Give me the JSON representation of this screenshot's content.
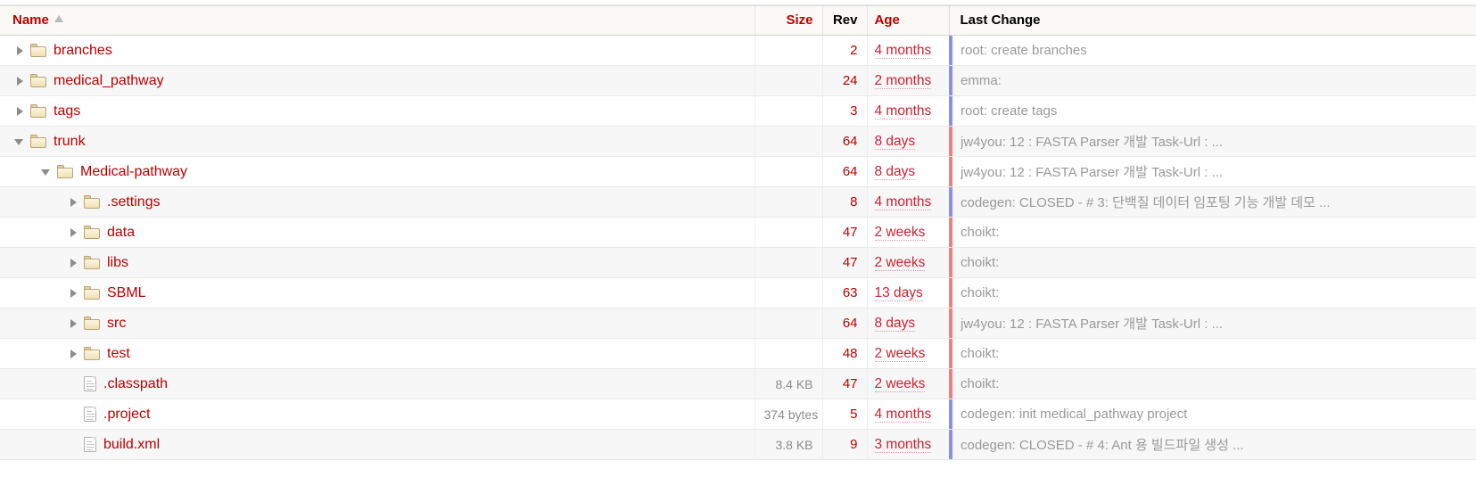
{
  "columns": {
    "name": {
      "label": "Name",
      "link": true,
      "sorted": true,
      "sort_dir": "asc"
    },
    "size": {
      "label": "Size",
      "link": true
    },
    "rev": {
      "label": "Rev",
      "link": false
    },
    "age": {
      "label": "Age",
      "link": true
    },
    "last_change": {
      "label": "Last Change",
      "link": false
    }
  },
  "colors": {
    "link_red": "#bb0000",
    "age_red": "#cc2233",
    "message_gray": "#999999",
    "header_bg": "#faf9f5",
    "row_alt_bg": "#f7f7f7",
    "age_bar_old": "#8e8ee8",
    "age_bar_recent": "#f08080"
  },
  "rows": [
    {
      "name": "branches",
      "kind": "dir",
      "depth": 0,
      "twisty": "collapsed",
      "size": "",
      "rev": "2",
      "age": "4 months",
      "change": "root: create branches",
      "bar": "old"
    },
    {
      "name": "medical_pathway",
      "kind": "dir",
      "depth": 0,
      "twisty": "collapsed",
      "size": "",
      "rev": "24",
      "age": "2 months",
      "change": "emma:",
      "bar": "old"
    },
    {
      "name": "tags",
      "kind": "dir",
      "depth": 0,
      "twisty": "collapsed",
      "size": "",
      "rev": "3",
      "age": "4 months",
      "change": "root: create tags",
      "bar": "old"
    },
    {
      "name": "trunk",
      "kind": "dir",
      "depth": 0,
      "twisty": "expanded",
      "size": "",
      "rev": "64",
      "age": "8 days",
      "change": "jw4you: 12 : FASTA Parser 개발 Task-Url : ...",
      "bar": "recent"
    },
    {
      "name": "Medical-pathway",
      "kind": "dir",
      "depth": 1,
      "twisty": "expanded",
      "size": "",
      "rev": "64",
      "age": "8 days",
      "change": "jw4you: 12 : FASTA Parser 개발 Task-Url : ...",
      "bar": "recent"
    },
    {
      "name": ".settings",
      "kind": "dir",
      "depth": 2,
      "twisty": "collapsed",
      "size": "",
      "rev": "8",
      "age": "4 months",
      "change": "codegen: CLOSED - # 3: 단백질 데이터 임포팅 기능 개발 데모 ...",
      "bar": "old"
    },
    {
      "name": "data",
      "kind": "dir",
      "depth": 2,
      "twisty": "collapsed",
      "size": "",
      "rev": "47",
      "age": "2 weeks",
      "change": "choikt:",
      "bar": "recent"
    },
    {
      "name": "libs",
      "kind": "dir",
      "depth": 2,
      "twisty": "collapsed",
      "size": "",
      "rev": "47",
      "age": "2 weeks",
      "change": "choikt:",
      "bar": "recent"
    },
    {
      "name": "SBML",
      "kind": "dir",
      "depth": 2,
      "twisty": "collapsed",
      "size": "",
      "rev": "63",
      "age": "13 days",
      "change": "choikt:",
      "bar": "recent"
    },
    {
      "name": "src",
      "kind": "dir",
      "depth": 2,
      "twisty": "collapsed",
      "size": "",
      "rev": "64",
      "age": "8 days",
      "change": "jw4you: 12 : FASTA Parser 개발 Task-Url : ...",
      "bar": "recent"
    },
    {
      "name": "test",
      "kind": "dir",
      "depth": 2,
      "twisty": "collapsed",
      "size": "",
      "rev": "48",
      "age": "2 weeks",
      "change": "choikt:",
      "bar": "recent"
    },
    {
      "name": ".classpath",
      "kind": "file",
      "depth": 2,
      "twisty": "none",
      "size": "8.4 KB",
      "rev": "47",
      "age": "2 weeks",
      "change": "choikt:",
      "bar": "recent"
    },
    {
      "name": ".project",
      "kind": "file",
      "depth": 2,
      "twisty": "none",
      "size": "374 bytes",
      "rev": "5",
      "age": "4 months",
      "change": "codegen: init medical_pathway project",
      "bar": "old"
    },
    {
      "name": "build.xml",
      "kind": "file",
      "depth": 2,
      "twisty": "none",
      "size": "3.8 KB",
      "rev": "9",
      "age": "3 months",
      "change": "codegen: CLOSED - # 4: Ant 용 빌드파일 생성 ...",
      "bar": "old"
    }
  ]
}
